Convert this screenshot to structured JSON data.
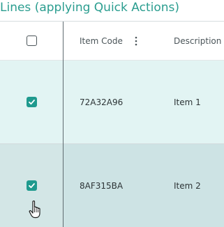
{
  "section": {
    "title": "Lines (applying Quick Actions)"
  },
  "table": {
    "headers": {
      "item_code": "Item Code",
      "description": "Description"
    },
    "select_all_checked": false,
    "rows": [
      {
        "checked": true,
        "item_code": "72A32A96",
        "description": "Item 1"
      },
      {
        "checked": true,
        "item_code": "8AF315BA",
        "description": "Item 2"
      }
    ]
  },
  "colors": {
    "title": "#2a9d8f",
    "checkbox_checked": "#1f9a8e",
    "row_selected": "#e2f4f3",
    "row_hover": "#cde3e4"
  },
  "icons": {
    "header_menu": "kebab-vertical-icon",
    "checkbox_check": "checkmark-icon",
    "pointer": "hand-pointer-icon"
  }
}
